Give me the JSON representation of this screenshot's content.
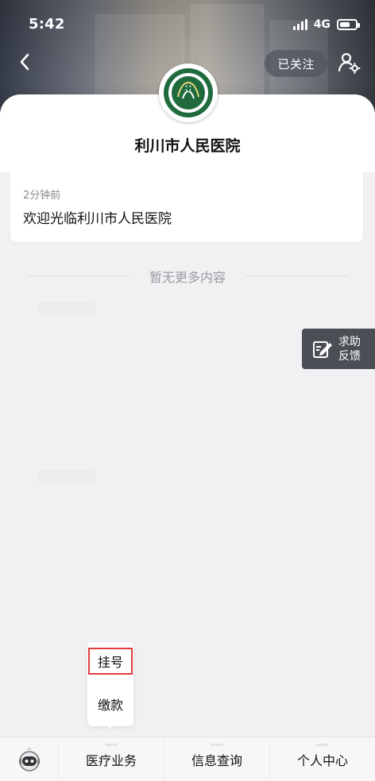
{
  "status_bar": {
    "time": "5:42",
    "network": "4G"
  },
  "header": {
    "follow_label": "已关注",
    "back_icon": "chevron-left-icon",
    "profile_icon": "user-settings-icon"
  },
  "hospital": {
    "name": "利川市人民医院",
    "logo_icon": "hospital-logo-icon"
  },
  "message": {
    "time": "2分钟前",
    "text": "欢迎光临利川市人民医院"
  },
  "feed_end_text": "暂无更多内容",
  "feedback": {
    "line1": "求助",
    "line2": "反馈",
    "icon": "edit-icon"
  },
  "popup_menu": {
    "items": [
      {
        "label": "挂号"
      },
      {
        "label": "缴款"
      }
    ]
  },
  "tabbar": {
    "avatar_icon": "assistant-avatar-icon",
    "items": [
      {
        "label": "医疗业务"
      },
      {
        "label": "信息查询"
      },
      {
        "label": "个人中心"
      }
    ]
  },
  "colors": {
    "accent_highlight": "#e23b3b",
    "logo_green": "#1f6b3d",
    "card_bg": "#f1f1f3"
  }
}
